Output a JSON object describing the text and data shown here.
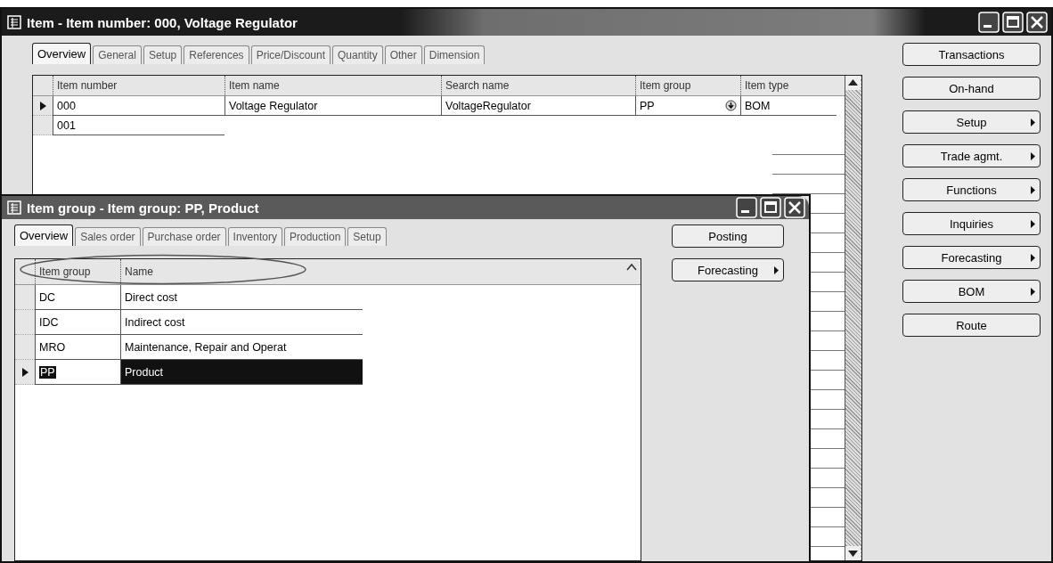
{
  "item_window": {
    "title": "Item - Item number: 000, Voltage Regulator",
    "tabs": [
      {
        "label": "Overview",
        "selected": true
      },
      {
        "label": "General",
        "selected": false
      },
      {
        "label": "Setup",
        "selected": false
      },
      {
        "label": "References",
        "selected": false
      },
      {
        "label": "Price/Discount",
        "selected": false
      },
      {
        "label": "Quantity",
        "selected": false
      },
      {
        "label": "Other",
        "selected": false
      },
      {
        "label": "Dimension",
        "selected": false
      }
    ],
    "grid": {
      "columns": [
        "Item number",
        "Item name",
        "Search name",
        "Item group",
        "Item type"
      ],
      "rows": [
        {
          "cells": [
            "000",
            "Voltage Regulator",
            "VoltageRegulator",
            "PP",
            "BOM"
          ],
          "selected": true
        },
        {
          "cells": [
            "001"
          ],
          "selected": false
        }
      ]
    },
    "buttons": [
      {
        "label": "Transactions",
        "submenu": false
      },
      {
        "label": "On-hand",
        "submenu": false
      },
      {
        "label": "Setup",
        "submenu": true
      },
      {
        "label": "Trade agmt.",
        "submenu": true
      },
      {
        "label": "Functions",
        "submenu": true
      },
      {
        "label": "Inquiries",
        "submenu": true
      },
      {
        "label": "Forecasting",
        "submenu": true
      },
      {
        "label": "BOM",
        "submenu": true
      },
      {
        "label": "Route",
        "submenu": false
      }
    ]
  },
  "item_group_window": {
    "title": "Item group - Item group: PP, Product",
    "tabs": [
      {
        "label": "Overview",
        "selected": true
      },
      {
        "label": "Sales order",
        "selected": false
      },
      {
        "label": "Purchase order",
        "selected": false
      },
      {
        "label": "Inventory",
        "selected": false
      },
      {
        "label": "Production",
        "selected": false
      },
      {
        "label": "Setup",
        "selected": false
      }
    ],
    "grid": {
      "columns": [
        "Item group",
        "Name"
      ],
      "rows": [
        {
          "cells": [
            "DC",
            "Direct cost"
          ],
          "selected": false
        },
        {
          "cells": [
            "IDC",
            "Indirect cost"
          ],
          "selected": false
        },
        {
          "cells": [
            "MRO",
            "Maintenance, Repair and Operat"
          ],
          "selected": false
        },
        {
          "cells": [
            "PP",
            "Product"
          ],
          "selected": true
        }
      ]
    },
    "buttons": [
      {
        "label": "Posting",
        "submenu": false
      },
      {
        "label": "Forecasting",
        "submenu": true
      }
    ]
  }
}
